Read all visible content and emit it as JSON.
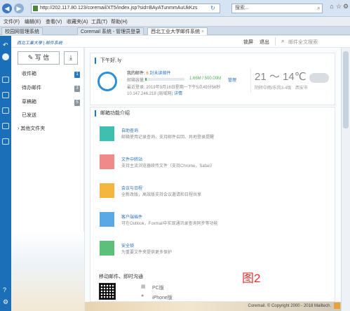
{
  "browser": {
    "url": "http://202.117.80.123/coremail/XT5/index.jsp?sid=BAyATunmmAuUkKzs",
    "search_placeholder": "搜索...",
    "menu": [
      "文件(F)",
      "编辑(E)",
      "查看(V)",
      "收藏夹(A)",
      "工具(T)",
      "帮助(H)"
    ],
    "tabs": [
      "校园网管理系统",
      "Coremail 系统 - 管理员登录",
      "西北工业大学邮件系统"
    ],
    "active_tab_index": 2
  },
  "app": {
    "logo_text": "西北工業大學 | 邮件系统",
    "header_links": [
      "锁屏",
      "退出"
    ],
    "search_placeholder": "邮件全文搜索"
  },
  "sidebar": {
    "compose_label": "写 信",
    "receive_icon": "inbox-download-icon",
    "folders": [
      {
        "label": "收件箱",
        "count": "1",
        "highlight": true
      },
      {
        "label": "待办邮件",
        "count": "3",
        "highlight": false
      },
      {
        "label": "草稿箱",
        "count": "5",
        "highlight": false
      },
      {
        "label": "已发送",
        "count": "",
        "highlight": false
      },
      {
        "label": "其他文件夹",
        "count": "",
        "highlight": false
      }
    ]
  },
  "welcome": {
    "greeting": "下午好, ly",
    "my_mail_label": "我的邮件:",
    "unread_count": "6",
    "unread_label": "封未读邮件",
    "capacity_label": "邮箱容量:",
    "capacity_value": "1.66M / 500.00M",
    "capacity_fraction": 0.0033,
    "manage_label": "管理",
    "last_login_label": "最近登录:",
    "last_login_value": "2019年9月16日星期一下午5点49分56秒",
    "last_ip": "10.147.246.218 (局域网)",
    "details_label": "详情",
    "temperature": "21 ～ 14℃",
    "weather_desc": "阴转中雨/东风3-4级",
    "city": "西安市"
  },
  "features": {
    "title": "邮箱功能介绍",
    "items": [
      {
        "title": "自助查询",
        "desc": "邮箱使用记录查询，支持邮件召回、异地登录提醒",
        "color": "#3fbfb0",
        "icon": "search-icon"
      },
      {
        "title": "文件中转站",
        "desc": "支持主流浏览器续传文件（支持Chrome，Safari）",
        "color": "#f08a8a",
        "icon": "folder-icon"
      },
      {
        "title": "会议与日程",
        "desc": "全新改版，高效版支持会议邀请和日程共享",
        "color": "#f5b640",
        "icon": "calendar-icon"
      },
      {
        "title": "客户端插件",
        "desc": "可在Outlook，Foxmail中实现通讯录查询同步等功能",
        "color": "#5aa9e6",
        "icon": "puzzle-icon"
      },
      {
        "title": "安全锁",
        "desc": "为重要文件夹提供更多保护",
        "color": "#5cc07a",
        "icon": "shield-icon"
      }
    ]
  },
  "mobile": {
    "title": "移动邮件、即时沟通",
    "platforms": [
      "PC版",
      "iPhone版"
    ],
    "annotation": "图2"
  },
  "footer": {
    "copyright": "Coremail. © Copyright 2000 - 2018 Mailtech."
  }
}
